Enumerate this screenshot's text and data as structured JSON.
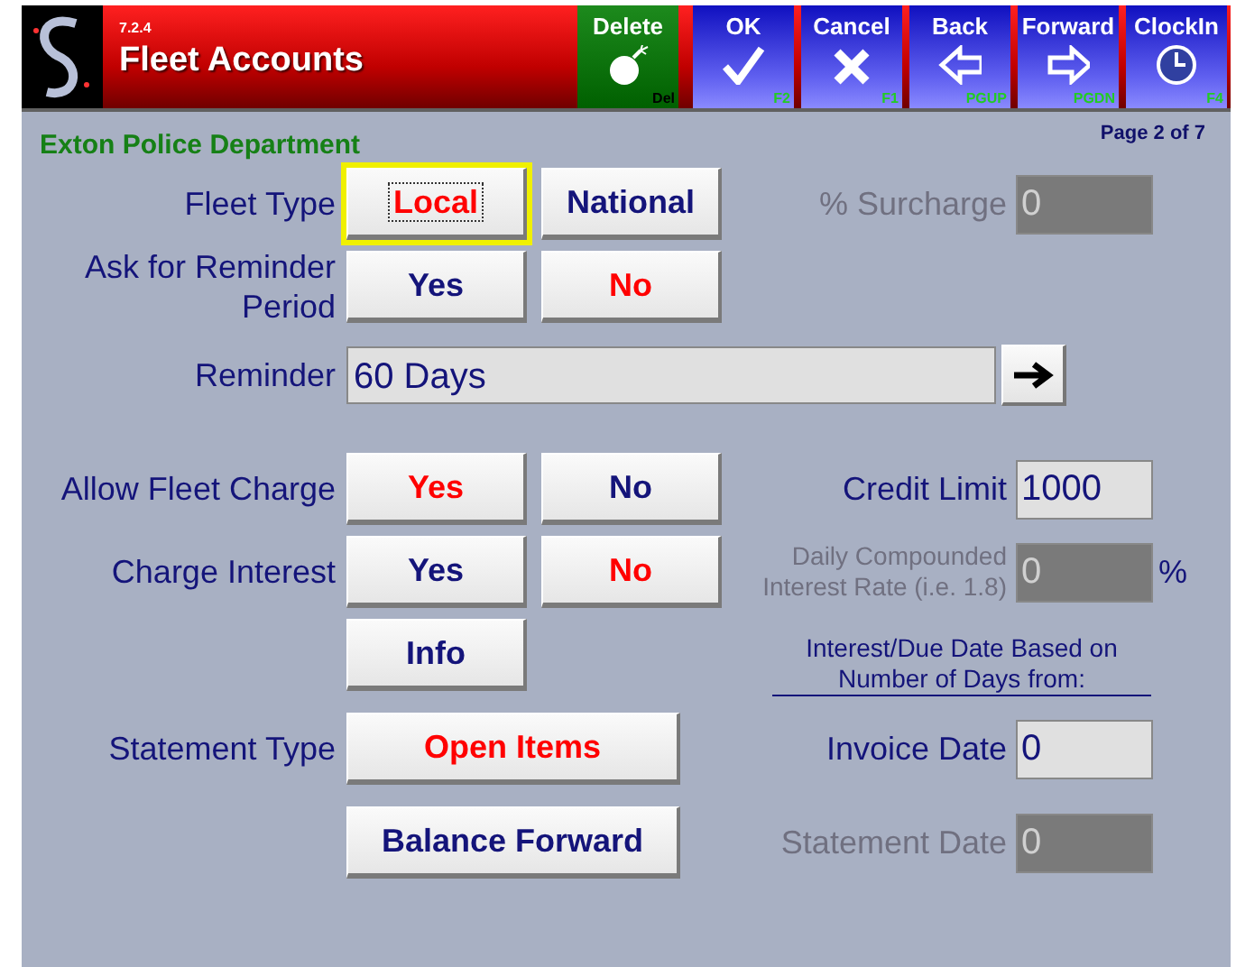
{
  "header": {
    "version": "7.2.4",
    "title": "Fleet Accounts"
  },
  "toolbar": [
    {
      "label": "Delete",
      "key": "Del",
      "kind": "green"
    },
    {
      "label": "OK",
      "key": "F2",
      "kind": "blue"
    },
    {
      "label": "Cancel",
      "key": "F1",
      "kind": "blue"
    },
    {
      "label": "Back",
      "key": "PGUP",
      "kind": "blue"
    },
    {
      "label": "Forward",
      "key": "PGDN",
      "kind": "blue"
    },
    {
      "label": "ClockIn",
      "key": "F4",
      "kind": "blue"
    }
  ],
  "organization": "Exton Police Department",
  "page": "Page 2 of 7",
  "rows": [
    {
      "kind": "choice",
      "label": "Fleet Type",
      "options": [
        {
          "label": "Local",
          "selected": true,
          "focused": true
        },
        {
          "label": "National",
          "selected": false,
          "focused": false
        }
      ],
      "side": {
        "kind": "field",
        "label": "% Surcharge",
        "value": "0",
        "disabled": true
      }
    },
    {
      "kind": "choice",
      "label": "Ask for Reminder Period",
      "options": [
        {
          "label": "Yes",
          "selected": false,
          "focused": false
        },
        {
          "label": "No",
          "selected": true,
          "focused": false
        }
      ]
    },
    {
      "kind": "select",
      "label": "Reminder",
      "value": "60 Days"
    },
    {
      "kind": "choice",
      "label": "Allow Fleet Charge",
      "options": [
        {
          "label": "Yes",
          "selected": true,
          "focused": false
        },
        {
          "label": "No",
          "selected": false,
          "focused": false
        }
      ],
      "side": {
        "kind": "field",
        "label": "Credit Limit",
        "value": "1000",
        "disabled": false
      }
    },
    {
      "kind": "choice",
      "label": "Charge Interest",
      "options": [
        {
          "label": "Yes",
          "selected": false,
          "focused": false
        },
        {
          "label": "No",
          "selected": true,
          "focused": false
        }
      ],
      "side": {
        "kind": "small_field",
        "label": "Daily Compounded Interest Rate (i.e. 1.8)",
        "value": "0",
        "disabled": true,
        "suffix": "%"
      }
    },
    {
      "kind": "choice",
      "options": [
        {
          "label": "Info",
          "selected": false,
          "focused": false
        }
      ],
      "side": {
        "kind": "note",
        "text": "Interest/Due Date Based on Number of Days from:"
      }
    },
    {
      "kind": "wide",
      "label": "Statement Type",
      "options": [
        {
          "label": "Open Items",
          "selected": true,
          "focused": false
        }
      ],
      "side": {
        "kind": "field",
        "label": "Invoice Date",
        "value": "0",
        "disabled": false
      }
    },
    {
      "kind": "wide",
      "options": [
        {
          "label": "Balance Forward",
          "selected": false,
          "focused": false
        }
      ],
      "side": {
        "kind": "field",
        "label": "Statement Date",
        "value": "0",
        "disabled": true
      }
    }
  ]
}
